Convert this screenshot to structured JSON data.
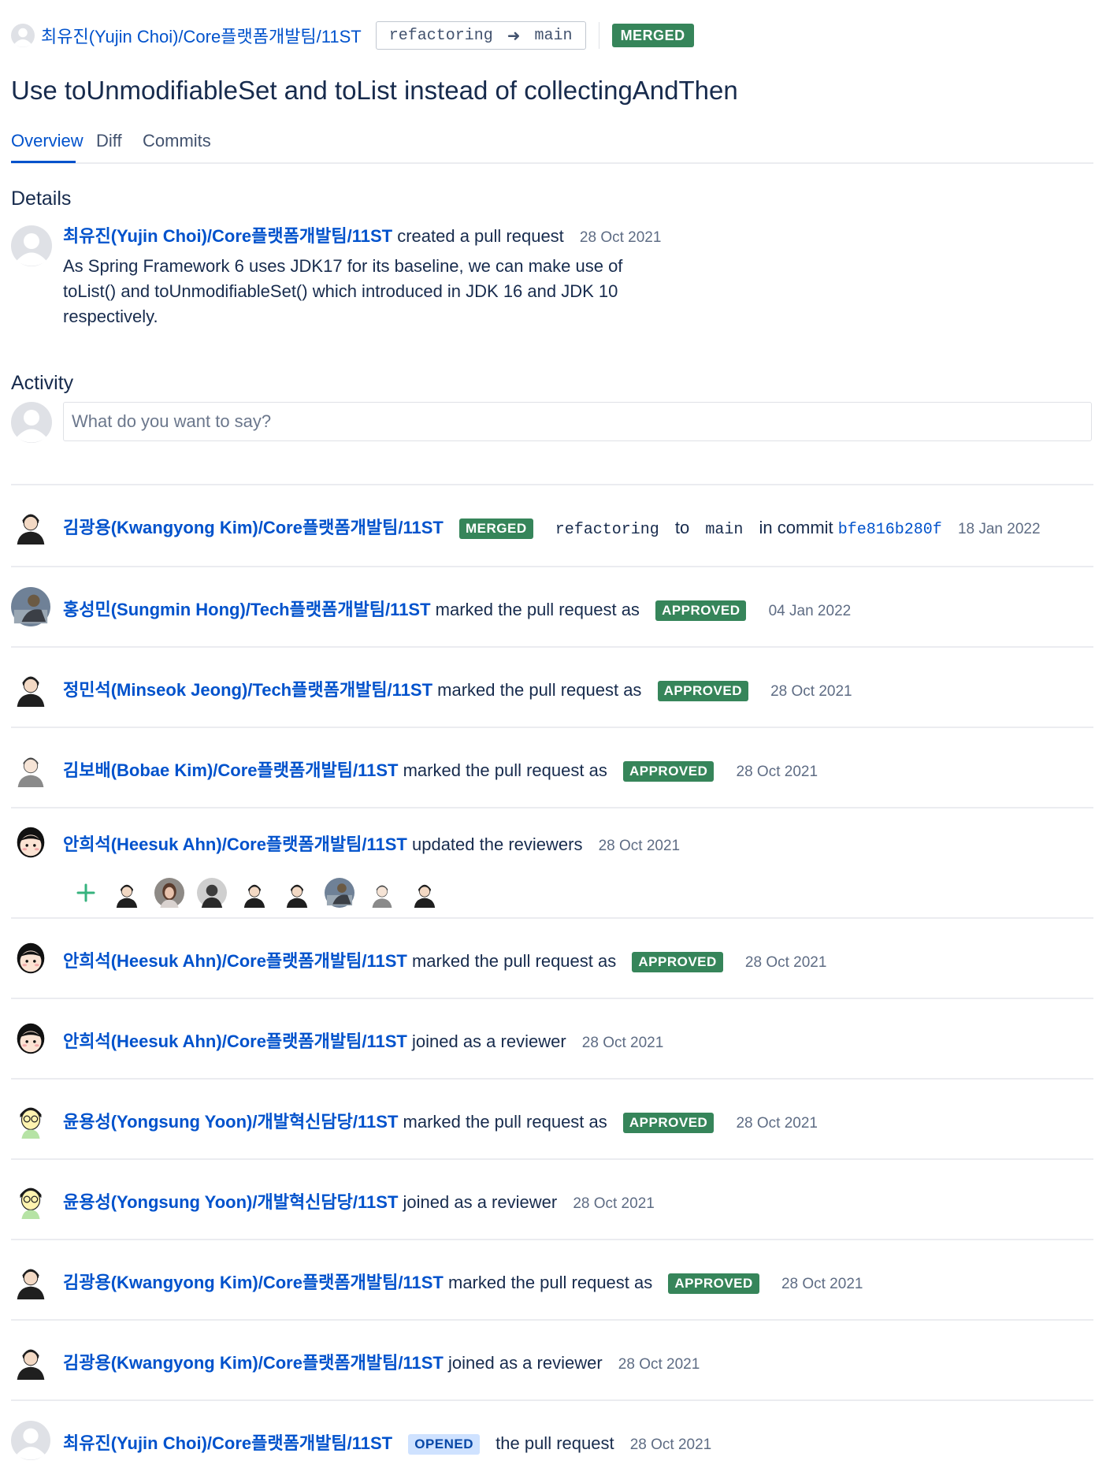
{
  "header": {
    "author": "최유진(Yujin Choi)/Core플랫폼개발팀/11ST",
    "source_branch": "refactoring",
    "target_branch": "main",
    "status": "MERGED"
  },
  "title": "Use toUnmodifiableSet and toList instead of collectingAndThen",
  "tabs": [
    "Overview",
    "Diff",
    "Commits"
  ],
  "details": {
    "heading": "Details",
    "author": "최유진(Yujin Choi)/Core플랫폼개발팀/11ST",
    "action": "created a pull request",
    "date": "28 Oct 2021",
    "description": "As Spring Framework 6 uses JDK17 for its baseline, we can make use of toList() and toUnmodifiableSet() which introduced in JDK 16 and JDK 10 respectively."
  },
  "activity": {
    "heading": "Activity",
    "comment_placeholder": "What do you want to say?",
    "items": [
      {
        "author": "김광용(Kwangyong Kim)/Core플랫폼개발팀/11ST",
        "status": "MERGED",
        "from": "refactoring",
        "to_word": "to",
        "to": "main",
        "commit_prefix": "in commit",
        "commit": "bfe816b280f",
        "date": "18 Jan 2022"
      },
      {
        "author": "홍성민(Sungmin Hong)/Tech플랫폼개발팀/11ST",
        "action": "marked the pull request as",
        "status": "APPROVED",
        "date": "04 Jan 2022"
      },
      {
        "author": "정민석(Minseok Jeong)/Tech플랫폼개발팀/11ST",
        "action": "marked the pull request as",
        "status": "APPROVED",
        "date": "28 Oct 2021"
      },
      {
        "author": "김보배(Bobae Kim)/Core플랫폼개발팀/11ST",
        "action": "marked the pull request as",
        "status": "APPROVED",
        "date": "28 Oct 2021"
      },
      {
        "author": "안희석(Heesuk Ahn)/Core플랫폼개발팀/11ST",
        "action": "updated the reviewers",
        "date": "28 Oct 2021"
      },
      {
        "author": "안희석(Heesuk Ahn)/Core플랫폼개발팀/11ST",
        "action": "marked the pull request as",
        "status": "APPROVED",
        "date": "28 Oct 2021"
      },
      {
        "author": "안희석(Heesuk Ahn)/Core플랫폼개발팀/11ST",
        "action": "joined as a reviewer",
        "date": "28 Oct 2021"
      },
      {
        "author": "윤용성(Yongsung Yoon)/개발혁신담당/11ST",
        "action": "marked the pull request as",
        "status": "APPROVED",
        "date": "28 Oct 2021"
      },
      {
        "author": "윤용성(Yongsung Yoon)/개발혁신담당/11ST",
        "action": "joined as a reviewer",
        "date": "28 Oct 2021"
      },
      {
        "author": "김광용(Kwangyong Kim)/Core플랫폼개발팀/11ST",
        "action": "marked the pull request as",
        "status": "APPROVED",
        "date": "28 Oct 2021"
      },
      {
        "author": "김광용(Kwangyong Kim)/Core플랫폼개발팀/11ST",
        "action": "joined as a reviewer",
        "date": "28 Oct 2021"
      },
      {
        "author": "최유진(Yujin Choi)/Core플랫폼개발팀/11ST",
        "status": "OPENED",
        "action": "the pull request",
        "date": "28 Oct 2021"
      }
    ]
  },
  "colors": {
    "link": "#0052cc",
    "approved": "#36855a",
    "opened": "#cfe2ff",
    "text": "#172b4d",
    "muted": "#5e6c84"
  }
}
